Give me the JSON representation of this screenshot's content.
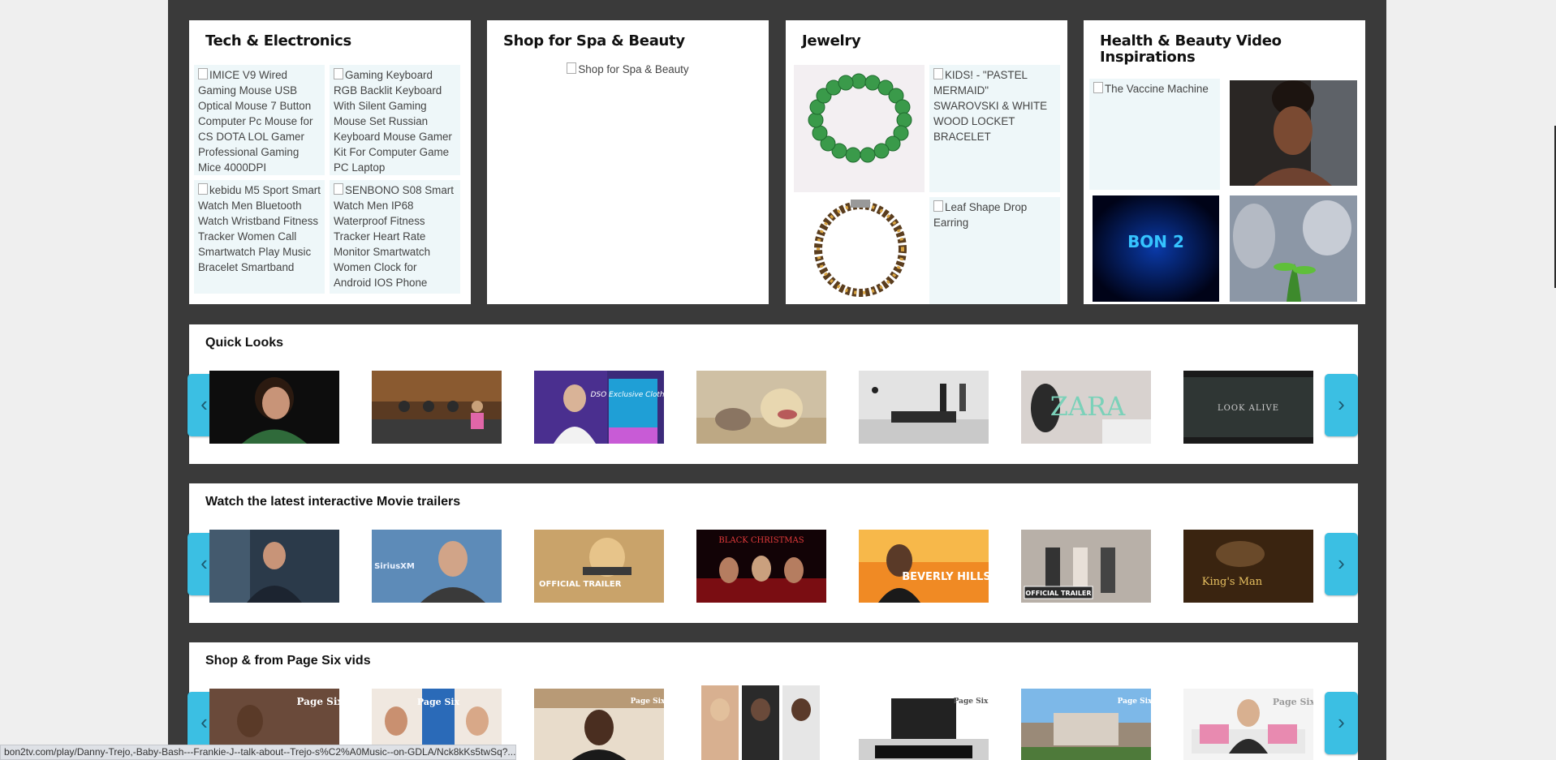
{
  "categories": {
    "tech": {
      "title": "Tech & Electronics",
      "items": [
        "IMICE V9 Wired Gaming Mouse USB Optical Mouse 7 Button Computer Pc Mouse for CS DOTA LOL Gamer Professional Gaming Mice 4000DPI",
        "Gaming Keyboard RGB Backlit Keyboard With Silent Gaming Mouse Set Russian Keyboard Mouse Gamer Kit For Computer Game PC Laptop",
        "kebidu M5 Sport Smart Watch Men Bluetooth Watch Wristband Fitness Tracker Women Call Smartwatch Play Music Bracelet Smartband",
        "SENBONO S08 Smart Watch Men IP68 Waterproof Fitness Tracker Heart Rate Monitor Smartwatch Women Clock for Android IOS Phone"
      ]
    },
    "spa": {
      "title": "Shop for Spa & Beauty",
      "image_alt": "Shop for Spa & Beauty"
    },
    "jewelry": {
      "title": "Jewelry",
      "items": [
        "KIDS! - \"PASTEL MERMAID\" SWAROVSKI & WHITE WOOD LOCKET BRACELET",
        "Leaf Shape Drop Earring"
      ]
    },
    "health": {
      "title": "Health & Beauty Video Inspirations",
      "item_alt": "The Vaccine Machine",
      "video_logo_text": "BON 2"
    }
  },
  "sections": [
    {
      "title": "Quick Looks",
      "thumbs": [
        {
          "name": "thumb-royal-smiling-woman",
          "overlay": ""
        },
        {
          "name": "thumb-talk-show-set",
          "overlay": ""
        },
        {
          "name": "thumb-exclusive-clothing",
          "overlay": "DSO Exclusive Clothing"
        },
        {
          "name": "thumb-dog-and-cat",
          "overlay": ""
        },
        {
          "name": "thumb-showroom",
          "overlay": ""
        },
        {
          "name": "thumb-zara",
          "overlay": "ZARA"
        },
        {
          "name": "thumb-look-alive",
          "overlay": "LOOK ALIVE"
        }
      ]
    },
    {
      "title": "Watch the latest interactive Movie trailers",
      "thumbs": [
        {
          "name": "thumb-man-in-suit",
          "overlay": ""
        },
        {
          "name": "thumb-siriusxm-interview",
          "overlay": "SiriusXM"
        },
        {
          "name": "thumb-official-trailer-action",
          "overlay": "OFFICIAL TRAILER"
        },
        {
          "name": "thumb-black-christmas",
          "overlay": "BLACK CHRISTMAS"
        },
        {
          "name": "thumb-beverly-hills-cop",
          "overlay": "BEVERLY HILLS"
        },
        {
          "name": "thumb-charlies-angels",
          "overlay": "OFFICIAL TRAILER"
        },
        {
          "name": "thumb-kings-man",
          "overlay": "King's Man"
        }
      ]
    },
    {
      "title": "Shop & from Page Six vids",
      "thumbs": [
        {
          "name": "thumb-page-six-1",
          "overlay": "Page Six"
        },
        {
          "name": "thumb-page-six-2",
          "overlay": "Page Six"
        },
        {
          "name": "thumb-page-six-3",
          "overlay": "Page Six"
        },
        {
          "name": "thumb-page-six-4",
          "overlay": ""
        },
        {
          "name": "thumb-page-six-5",
          "overlay": "Page Six"
        },
        {
          "name": "thumb-page-six-6",
          "overlay": "Page Six"
        },
        {
          "name": "thumb-page-six-7",
          "overlay": "Page Six"
        }
      ]
    }
  ],
  "arrows": {
    "left": "‹",
    "right": "›"
  },
  "status_url": "bon2tv.com/play/Danny-Trejo,-Baby-Bash---Frankie-J--talk-about--Trejo-s%C2%A0Music--on-GDLA/Nck8kKs5twSq?...",
  "colors": {
    "accent_arrow": "#3bbfe3",
    "frame": "#3a3a3a",
    "tile_bg": "#eef7f9"
  }
}
